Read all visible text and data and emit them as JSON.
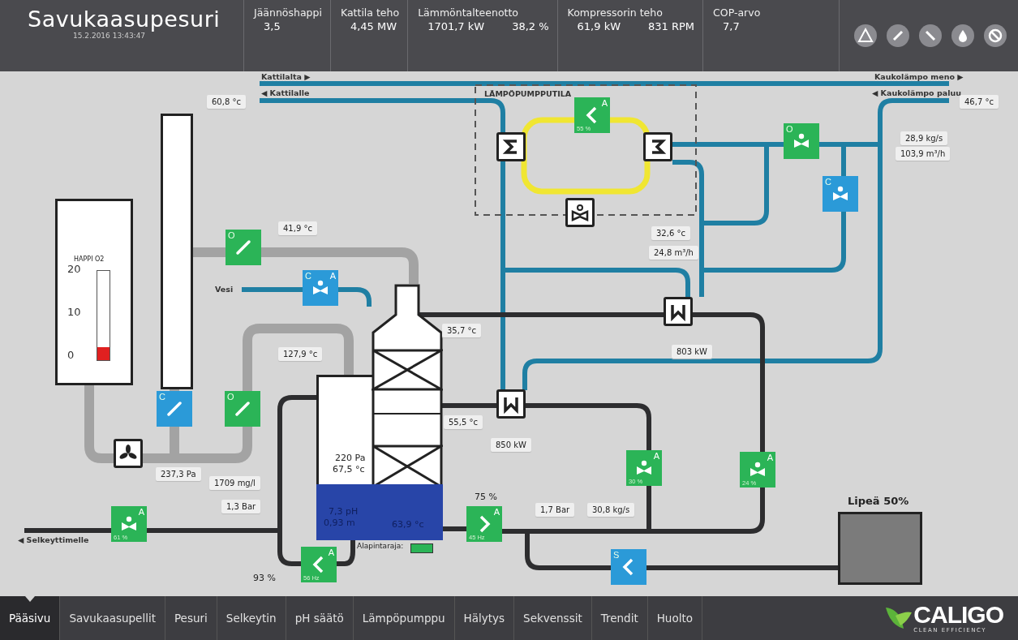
{
  "header": {
    "title": "Savukaasupesuri",
    "timestamp": "15.2.2016 13:43:47",
    "metrics": [
      {
        "label": "Jäännöshappi",
        "values": [
          "3,5"
        ]
      },
      {
        "label": "Kattila teho",
        "values": [
          "4,45 MW"
        ]
      },
      {
        "label": "Lämmöntalteenotto",
        "values": [
          "1701,7 kW",
          "38,2 %"
        ]
      },
      {
        "label": "Kompressorin teho",
        "values": [
          "61,9 kW",
          "831 RPM"
        ]
      },
      {
        "label": "COP-arvo",
        "values": [
          "7,7"
        ]
      }
    ]
  },
  "diagram": {
    "pipe_labels": [
      {
        "text": "Kattilalta ▶"
      },
      {
        "text": "◀ Kattilalle"
      },
      {
        "text": "Kaukolämpo meno ▶"
      },
      {
        "text": "◀ Kaukolämpo paluu"
      },
      {
        "text": "◀ Selkeyttimelle"
      },
      {
        "text": "Vesi"
      },
      {
        "text": "LÄMPÖPUMPPUTILA"
      }
    ],
    "readings": [
      {
        "text": "60,8 °c"
      },
      {
        "text": "46,7 °c"
      },
      {
        "text": "28,9 kg/s"
      },
      {
        "text": "103,9 m³/h"
      },
      {
        "text": "41,9 °c"
      },
      {
        "text": "127,9 °c"
      },
      {
        "text": "35,7 °c"
      },
      {
        "text": "32,6 °c"
      },
      {
        "text": "24,8 m³/h"
      },
      {
        "text": "803 kW"
      },
      {
        "text": "55,5 °c"
      },
      {
        "text": "850 kW"
      },
      {
        "text": "237,3 Pa"
      },
      {
        "text": "1709 mg/l"
      },
      {
        "text": "1,3 Bar"
      },
      {
        "text": "1,7 Bar"
      },
      {
        "text": "30,8 kg/s"
      }
    ],
    "values": [
      {
        "text": "93 %"
      },
      {
        "text": "75 %"
      },
      {
        "text": "220 Pa"
      },
      {
        "text": "67,5 °c"
      },
      {
        "text": "7,3 pH"
      },
      {
        "text": "0,93 m"
      },
      {
        "text": "63,9 °c"
      }
    ],
    "valves": [
      {
        "kind": "chevron-left",
        "color": "#2bb457",
        "auto": "A",
        "caption": "55 %"
      },
      {
        "kind": "valve",
        "color": "#2bb457",
        "mode": "O"
      },
      {
        "kind": "valve",
        "color": "#2b9ad8",
        "mode": "C"
      },
      {
        "kind": "damper",
        "color": "#2bb457",
        "mode": "O"
      },
      {
        "kind": "valve",
        "color": "#2b9ad8",
        "mode": "C",
        "auto": "A"
      },
      {
        "kind": "damper",
        "color": "#2b9ad8",
        "mode": "C"
      },
      {
        "kind": "damper",
        "color": "#2bb457",
        "mode": "O"
      },
      {
        "kind": "valve",
        "color": "#2bb457",
        "auto": "A",
        "caption": "61 %"
      },
      {
        "kind": "chevron-left",
        "color": "#2bb457",
        "auto": "A",
        "caption": "56 Hz"
      },
      {
        "kind": "chevron-right",
        "color": "#2bb457",
        "auto": "A",
        "caption": "45 Hz"
      },
      {
        "kind": "valve",
        "color": "#2bb457",
        "auto": "A",
        "caption": "30 %"
      },
      {
        "kind": "valve",
        "color": "#2bb457",
        "auto": "A",
        "caption": "24 %"
      },
      {
        "kind": "chevron-left",
        "color": "#2b9ad8",
        "mode": "S"
      }
    ],
    "symbols": [
      {
        "kind": "sigma"
      },
      {
        "kind": "sigma-mirrored"
      },
      {
        "kind": "expansion-valve"
      },
      {
        "kind": "w"
      },
      {
        "kind": "w"
      },
      {
        "kind": "fan"
      }
    ],
    "oxygen_gauge": {
      "label": "HAPPI O2",
      "ticks": [
        "20",
        "10",
        "0"
      ],
      "level": 0.15
    },
    "low_level": {
      "label": "Alapintaraja:",
      "on": true
    },
    "tank": {
      "label": "Lipeä 50%"
    }
  },
  "nav": {
    "tabs": [
      {
        "label": "Pääsivu",
        "selected": true
      },
      {
        "label": "Savukaasupellit",
        "selected": false
      },
      {
        "label": "Pesuri",
        "selected": false
      },
      {
        "label": "Selkeytin",
        "selected": false
      },
      {
        "label": "pH säätö",
        "selected": false
      },
      {
        "label": "Lämpöpumppu",
        "selected": false
      },
      {
        "label": "Hälytys",
        "selected": false
      },
      {
        "label": "Sekvenssit",
        "selected": false
      },
      {
        "label": "Trendit",
        "selected": false
      },
      {
        "label": "Huolto",
        "selected": false
      }
    ],
    "logo": {
      "name": "CALIGO",
      "tagline": "CLEAN EFFICIENCY"
    }
  }
}
